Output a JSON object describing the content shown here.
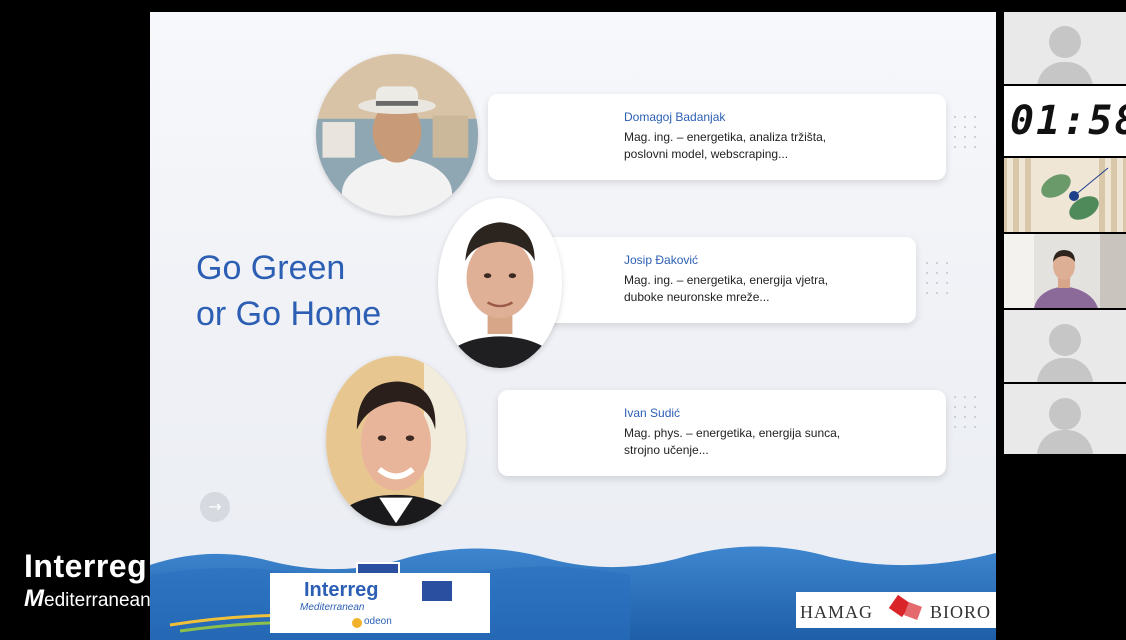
{
  "slide": {
    "title_lines": [
      "Go Green",
      "or Go Home"
    ],
    "people": [
      {
        "name": "Domagoj Badanjak",
        "desc_line1": "Mag. ing. – energetika, analiza tržišta,",
        "desc_line2": "poslovni model, webscraping..."
      },
      {
        "name": "Josip Đaković",
        "desc_line1": "Mag. ing. – energetika, energija vjetra,",
        "desc_line2": "duboke neuronske mreže..."
      },
      {
        "name": "Ivan Sudić",
        "desc_line1": "Mag. phys. – energetika, energija sunca,",
        "desc_line2": "strojno učenje..."
      }
    ],
    "next_arrow": "→"
  },
  "footer": {
    "interreg_big": "Interreg",
    "interreg_sub": "editerranean",
    "interreg_m": "M",
    "logo_box_big": "Interreg",
    "logo_box_sub": "Mediterranean",
    "logo_box_odeon": "odeon",
    "partner_hamag": "HAMAG",
    "partner_bioro": "BIORO"
  },
  "sidebar": {
    "timer": "01:58"
  },
  "colors": {
    "accent_blue": "#2c5fb4",
    "sea_blue": "#2b73c4",
    "black_bg": "#000000"
  }
}
